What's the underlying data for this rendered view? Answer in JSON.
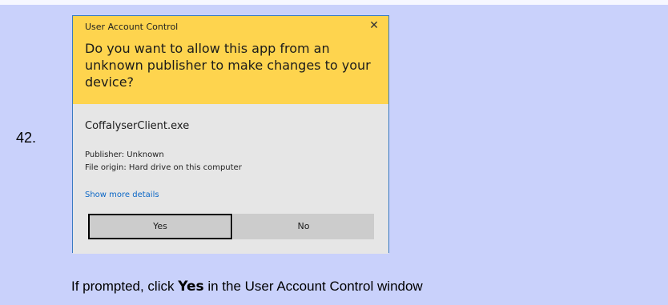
{
  "step": {
    "number": "42."
  },
  "dialog": {
    "title": "User Account Control",
    "close_glyph": "✕",
    "question": "Do you want to allow this app from an unknown publisher to make changes to your device?",
    "app_name": "CoffalyserClient.exe",
    "publisher": "Publisher: Unknown",
    "file_origin": "File origin: Hard drive on this computer",
    "more_details": "Show more details",
    "yes_label": "Yes",
    "no_label": "No"
  },
  "instruction": {
    "before": "If prompted, click ",
    "bold": "Yes",
    "after": " in the User Account Control window"
  },
  "colors": {
    "page_background": "#c9d1fb",
    "header_yellow": "#fed44e",
    "dialog_body": "#e6e6e6",
    "link_blue": "#0b67c6",
    "dialog_border": "#3a7ac2"
  },
  "icons": {
    "close": "close-icon"
  }
}
